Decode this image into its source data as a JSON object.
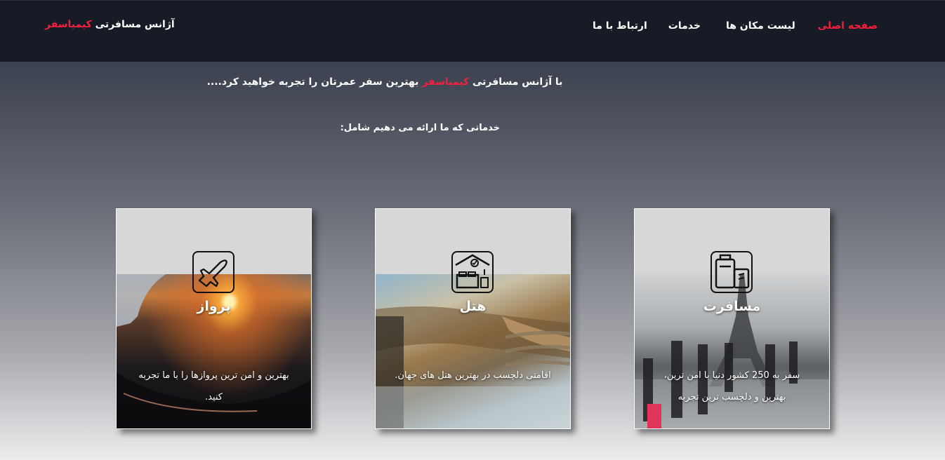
{
  "nav": {
    "brand_prefix": "آژانس مسافرتی",
    "brand_name": "کیمیاسفر",
    "links": [
      {
        "label": "صفحه اصلی",
        "active": true
      },
      {
        "label": "لیست مکان ها",
        "active": false
      },
      {
        "label": "خدمات",
        "active": false
      },
      {
        "label": "ارتباط با ما",
        "active": false
      }
    ]
  },
  "hero": {
    "tagline_start": "با آژانس مسافرتی",
    "tagline_brand": "کیمیاسفر",
    "tagline_end": "بهترین سفر عمرتان را تجربه خواهید کرد....",
    "services_intro": "خدماتی که ما ارائه می دهیم شامل:"
  },
  "cards": [
    {
      "title": "مسافرت",
      "description": "سفر به 250 کشور دنیا با امن ترین، بهترین و دلچسب ترین تجربه",
      "icon": "luggage-icon"
    },
    {
      "title": "هتل",
      "description": "اقامتی دلچسب در بهترین هتل های جهان.",
      "icon": "hotel-icon"
    },
    {
      "title": "پرواز",
      "description": "بهترین و امن ترین پروازها را با ما تجربه کنید.",
      "icon": "airplane-icon"
    }
  ],
  "colors": {
    "accent": "#f0213e",
    "navbar": "#161b26"
  }
}
